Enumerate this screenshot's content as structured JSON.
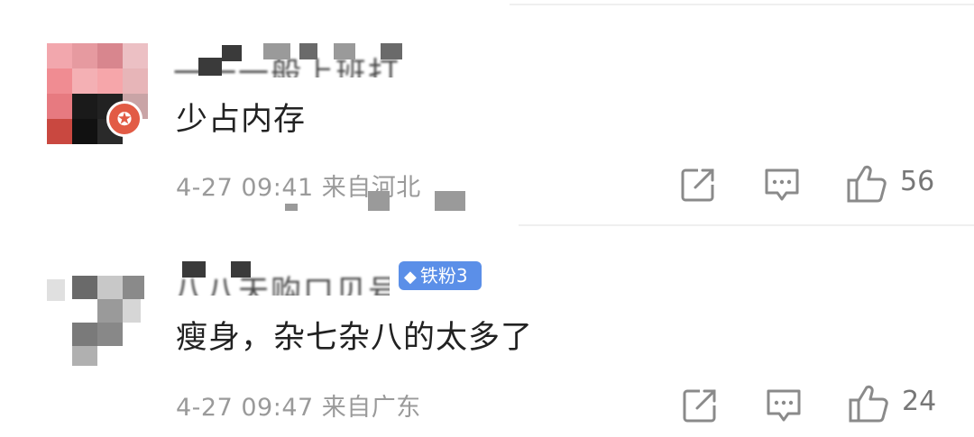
{
  "comments": [
    {
      "username": "一一一般上班打",
      "content": "少占内存",
      "meta": "4-27 09:41 来自河北",
      "likes": "56",
      "avatar_badge_icon": "star-badge-icon"
    },
    {
      "username": "八八天购口贝号",
      "fan_badge": "铁粉3",
      "content": "瘦身，杂七杂八的太多了",
      "meta": "4-27 09:47 来自广东",
      "likes": "24"
    }
  ],
  "icons": {
    "share": "share-icon",
    "comment": "comment-icon",
    "like": "thumbs-up-icon"
  },
  "colors": {
    "badge_star": "#e25b45",
    "fan_badge": "#5b8fe8",
    "meta_gray": "#9a9a9a",
    "content_text": "#222222"
  }
}
